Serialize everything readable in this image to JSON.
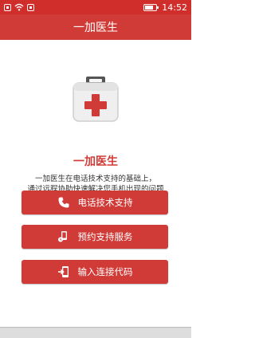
{
  "status_bar": {
    "time": "14:52"
  },
  "header": {
    "title": "一加医生"
  },
  "main": {
    "app_name": "一加医生",
    "description_line1": "一加医生在电话技术支持的基础上，",
    "description_line2": "通过远程协助快速解决您手机出现的问题",
    "buttons": [
      {
        "label": "电话技术支持",
        "icon": "phone-icon"
      },
      {
        "label": "预约支持服务",
        "icon": "appointment-icon"
      },
      {
        "label": "输入连接代码",
        "icon": "connect-code-icon"
      }
    ]
  },
  "colors": {
    "accent": "#d13b37",
    "status_bar": "#cf2e2b"
  }
}
